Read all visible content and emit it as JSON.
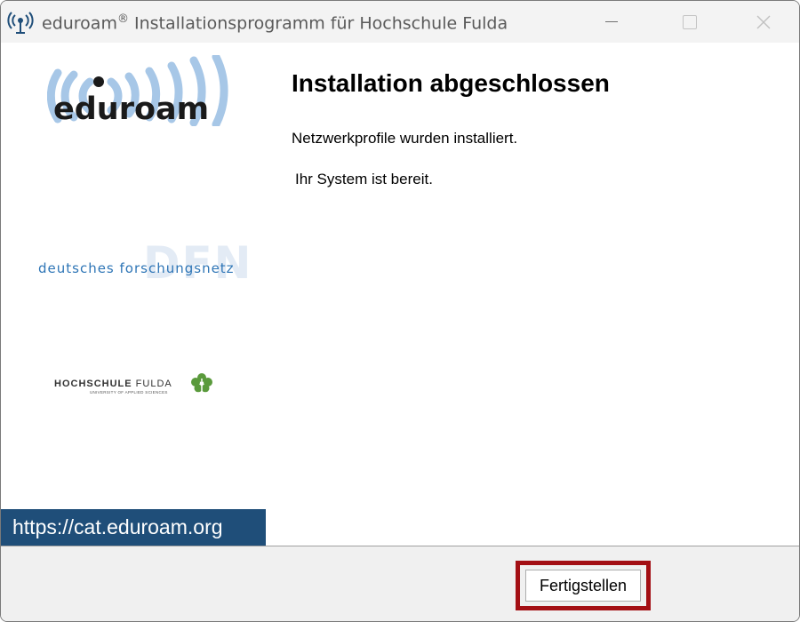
{
  "window": {
    "title_app": "eduroam",
    "title_mark": "®",
    "title_rest": " Installationsprogramm für Hochschule Fulda"
  },
  "main": {
    "heading": "Installation abgeschlossen",
    "message_profiles": "Netzwerkprofile wurden installiert.",
    "message_ready": "Ihr System ist bereit."
  },
  "sidebar": {
    "eduroam_logo_text": "eduroam",
    "dfn_logo_text": "DFN",
    "dfn_subtitle": "deutsches forschungsnetz",
    "hs_name_bold": "HOCHSCHULE",
    "hs_name_light": " FULDA",
    "hs_subtitle": "UNIVERSITY OF APPLIED SCIENCES",
    "url": "https://cat.eduroam.org"
  },
  "footer": {
    "finish_label": "Fertigstellen"
  },
  "colors": {
    "url_badge_bg": "#1f4e79",
    "highlight_frame": "#a30f14",
    "eduroam_waves": "#a7c7e7",
    "dfn_blue": "#2e75b6",
    "hs_green": "#5a9a3c"
  },
  "icons": {
    "app_icon": "eduroam-antenna-icon",
    "minimize": "minimize-icon",
    "maximize": "maximize-icon",
    "close": "close-icon",
    "hs_logo": "leaf-icon"
  }
}
